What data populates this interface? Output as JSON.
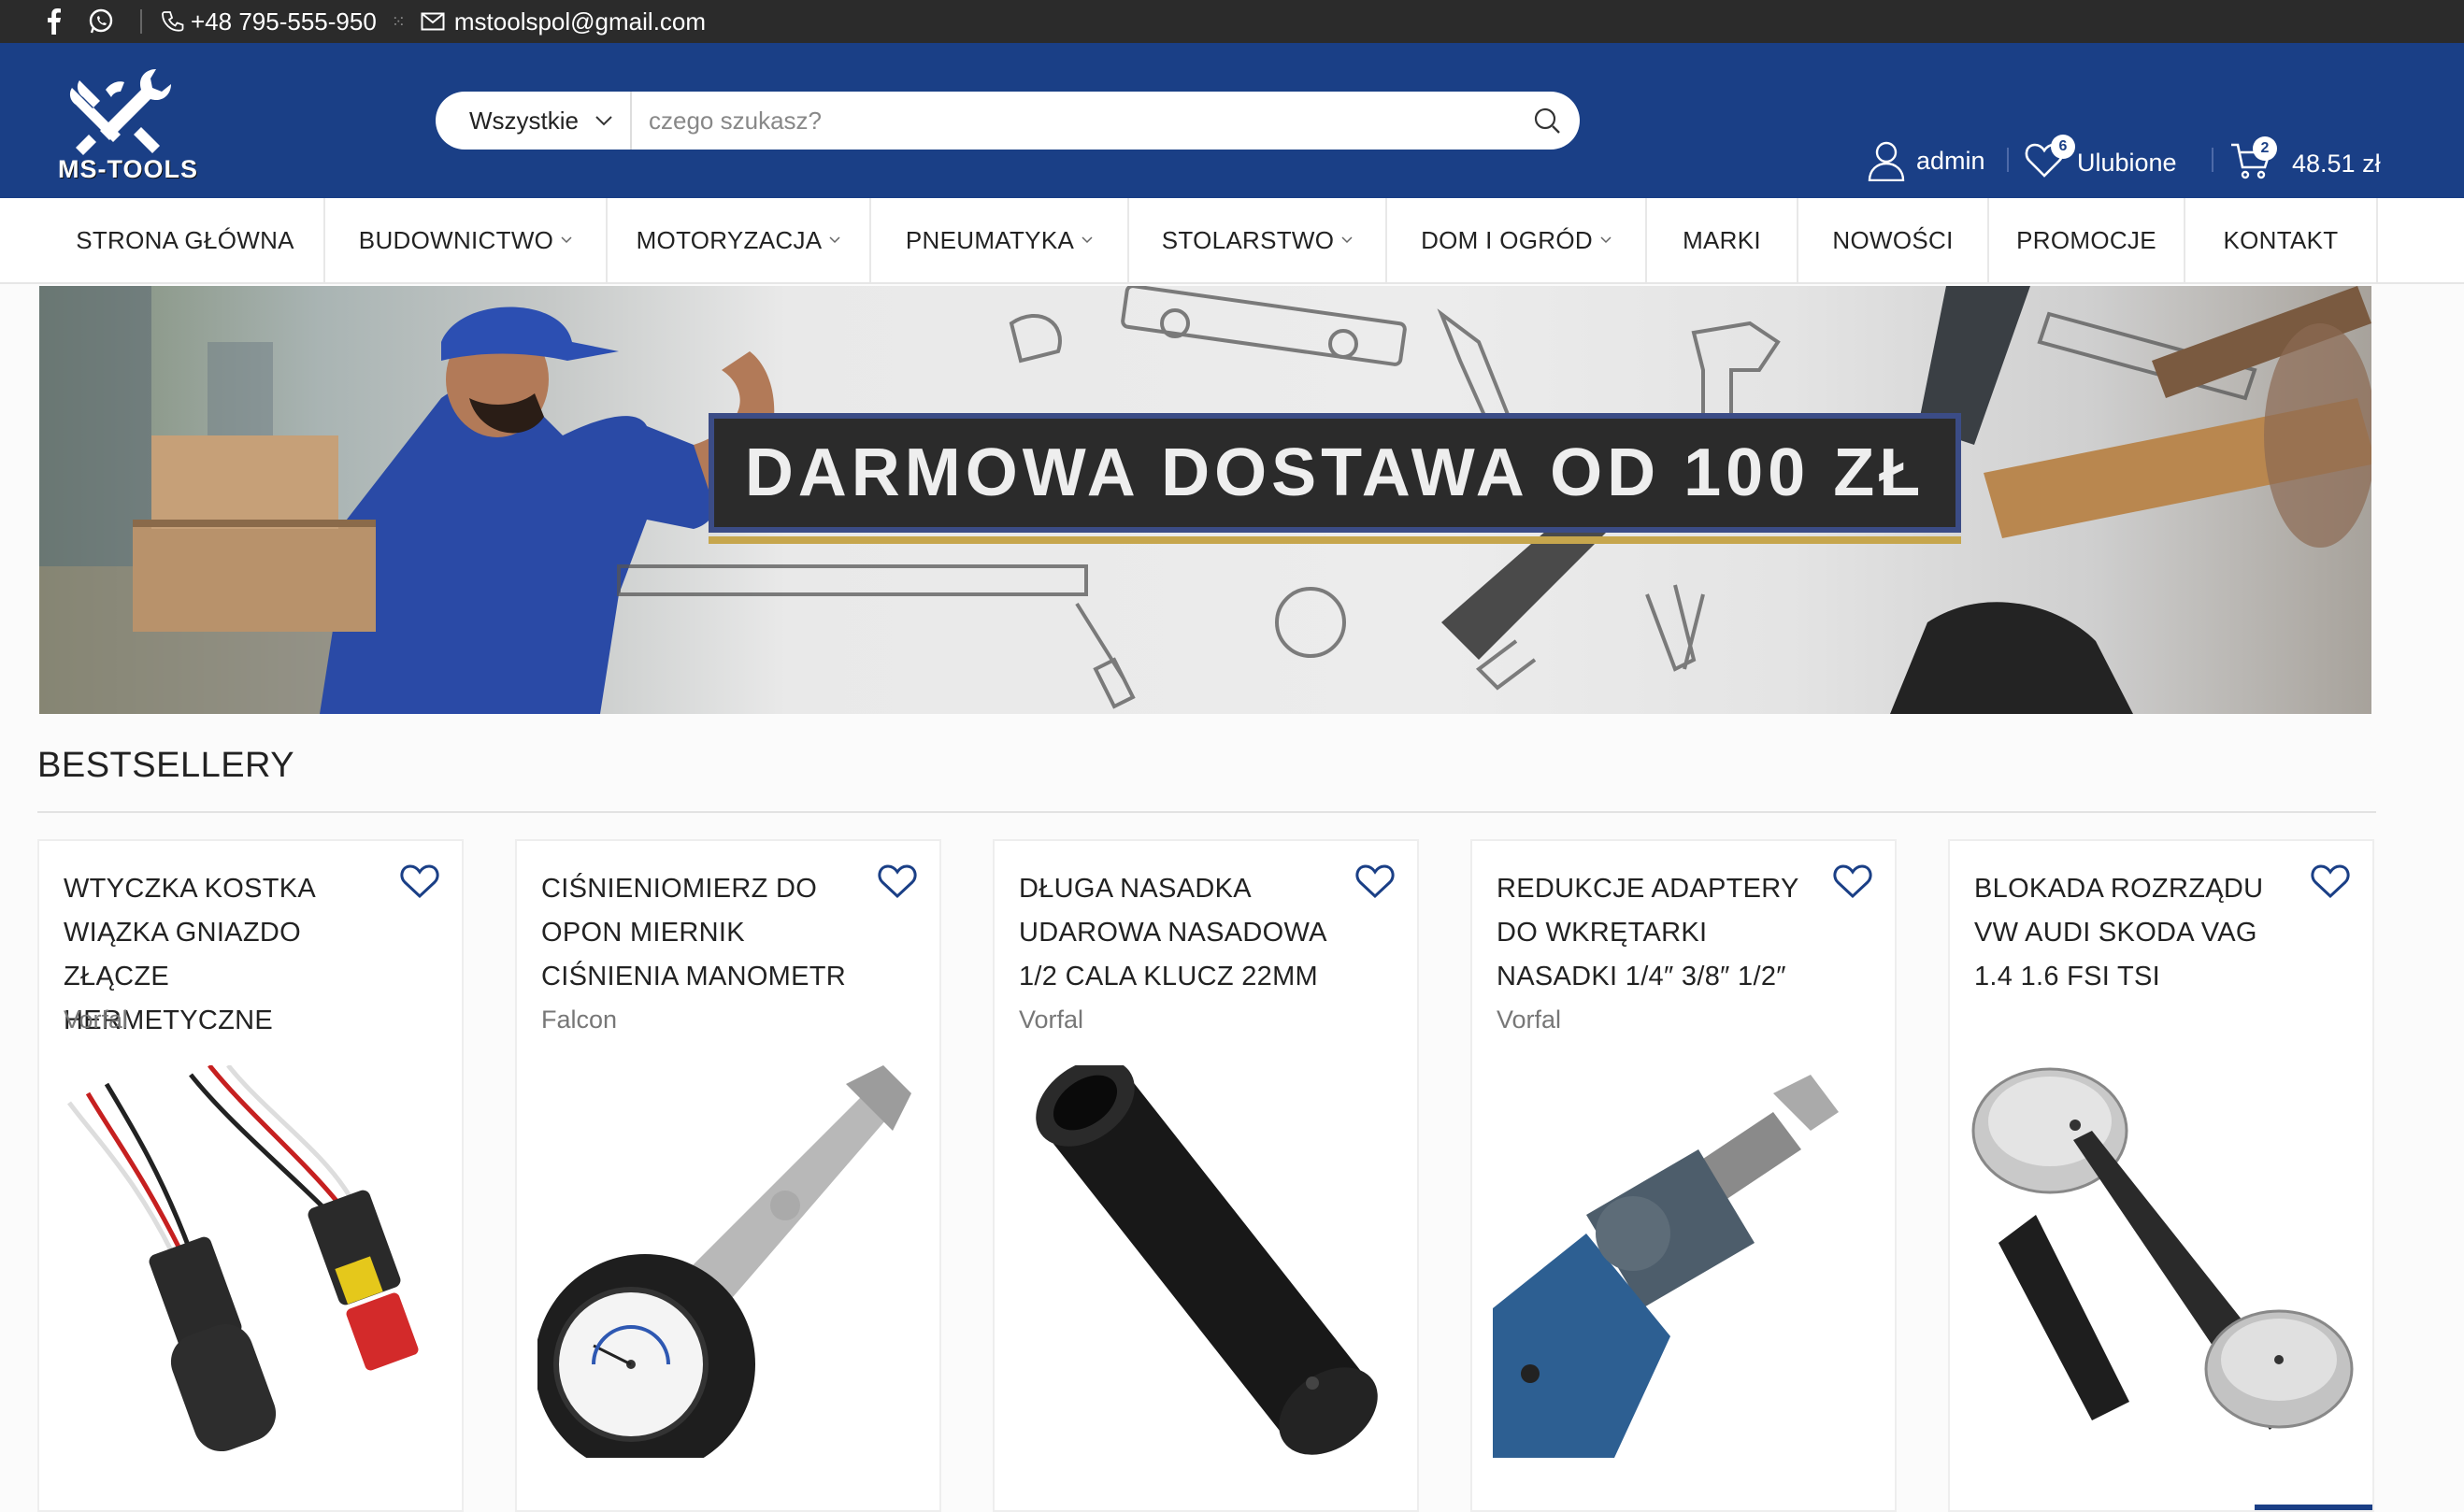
{
  "topbar": {
    "phone": "+48 795-555-950",
    "email": "mstoolspol@gmail.com"
  },
  "header": {
    "logo_text": "MS-TOOLS",
    "search_category": "Wszystkie",
    "search_placeholder": "czego szukasz?",
    "user_label": "admin",
    "wishlist_label": "Ulubione",
    "wishlist_count": "6",
    "cart_count": "2",
    "cart_total": "48.51 zł"
  },
  "nav": {
    "items": [
      {
        "label": "STRONA GŁÓWNA",
        "dropdown": false
      },
      {
        "label": "BUDOWNICTWO",
        "dropdown": true
      },
      {
        "label": "MOTORYZACJA",
        "dropdown": true
      },
      {
        "label": "PNEUMATYKA",
        "dropdown": true
      },
      {
        "label": "STOLARSTWO",
        "dropdown": true
      },
      {
        "label": "DOM I OGRÓD",
        "dropdown": true
      },
      {
        "label": "MARKI",
        "dropdown": false
      },
      {
        "label": "NOWOŚCI",
        "dropdown": false
      },
      {
        "label": "PROMOCJE",
        "dropdown": false
      },
      {
        "label": "KONTAKT",
        "dropdown": false
      }
    ]
  },
  "banner": {
    "title": "DARMOWA DOSTAWA OD 100 ZŁ"
  },
  "bestsellers": {
    "title": "BESTSELLERY",
    "products": [
      {
        "title": "WTYCZKA KOSTKA WIĄZKA GNIAZDO ZŁĄCZE HERMETYCZNE",
        "brand": "Vorfal"
      },
      {
        "title": "CIŚNIENIOMIERZ DO OPON MIERNIK CIŚNIENIA MANOMETR",
        "brand": "Falcon"
      },
      {
        "title": "DŁUGA NASADKA UDAROWA NASADOWA 1/2 CALA KLUCZ 22MM",
        "brand": "Vorfal"
      },
      {
        "title": "REDUKCJE ADAPTERY DO WKRĘTARKI NASADKI 1/4″ 3/8″ 1/2″",
        "brand": "Vorfal"
      },
      {
        "title": "BLOKADA ROZRZĄDU VW AUDI SKODA VAG 1.4 1.6 FSI TSI",
        "brand": ""
      }
    ]
  },
  "colors": {
    "header_bg": "#1a3f86",
    "topbar_bg": "#2b2b2b"
  }
}
